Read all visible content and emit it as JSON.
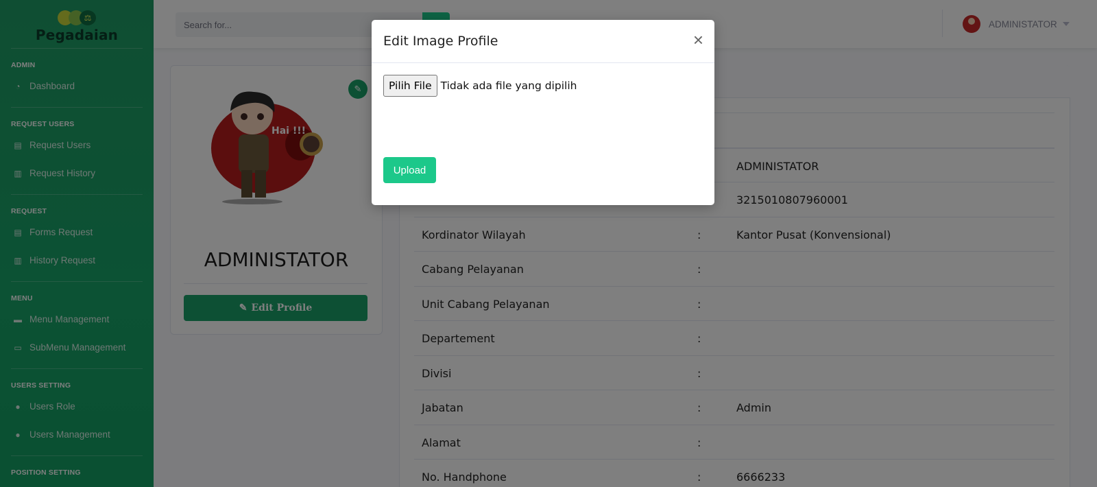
{
  "sidebar": {
    "brand": "Pegadaian",
    "brand_logo_glyph": "⚖",
    "sections": [
      {
        "heading": "ADMIN",
        "items": [
          {
            "label": "Dashboard",
            "icon": "tachometer-icon"
          }
        ]
      },
      {
        "heading": "REQUEST USERS",
        "items": [
          {
            "label": "Request Users",
            "icon": "clipboard-icon"
          },
          {
            "label": "Request History",
            "icon": "book-icon"
          }
        ]
      },
      {
        "heading": "REQUEST",
        "items": [
          {
            "label": "Forms Request",
            "icon": "clipboard-icon"
          },
          {
            "label": "History Request",
            "icon": "book-icon"
          }
        ]
      },
      {
        "heading": "MENU",
        "items": [
          {
            "label": "Menu Management",
            "icon": "folder-icon"
          },
          {
            "label": "SubMenu Management",
            "icon": "folder-open-icon"
          }
        ]
      },
      {
        "heading": "USERS SETTING",
        "items": [
          {
            "label": "Users Role",
            "icon": "user-icon"
          },
          {
            "label": "Users Management",
            "icon": "user-icon"
          }
        ]
      },
      {
        "heading": "POSITION SETTING",
        "items": []
      }
    ]
  },
  "topbar": {
    "search_placeholder": "Search for...",
    "user_name": "ADMINISTATOR"
  },
  "profile": {
    "name": "ADMINISTATOR",
    "edit_button": "Edit Profile",
    "avatar_caption": "Hai !!!"
  },
  "details": [
    {
      "label": "",
      "value": "ADMINISTATOR"
    },
    {
      "label": "",
      "value": "3215010807960001"
    },
    {
      "label": "Kordinator Wilayah",
      "value": "Kantor Pusat (Konvensional)"
    },
    {
      "label": "Cabang Pelayanan",
      "value": ""
    },
    {
      "label": "Unit Cabang Pelayanan",
      "value": ""
    },
    {
      "label": "Departement",
      "value": ""
    },
    {
      "label": "Divisi",
      "value": ""
    },
    {
      "label": "Jabatan",
      "value": "Admin"
    },
    {
      "label": "Alamat",
      "value": ""
    },
    {
      "label": "No. Handphone",
      "value": "6666233"
    }
  ],
  "modal": {
    "title": "Edit Image Profile",
    "close": "×",
    "file_button": "Pilih File",
    "file_status": "Tidak ada file yang dipilih",
    "upload": "Upload"
  },
  "colors": {
    "sidebar": "#1f9d66",
    "primary": "#1aa069",
    "success": "#1cc88a"
  }
}
